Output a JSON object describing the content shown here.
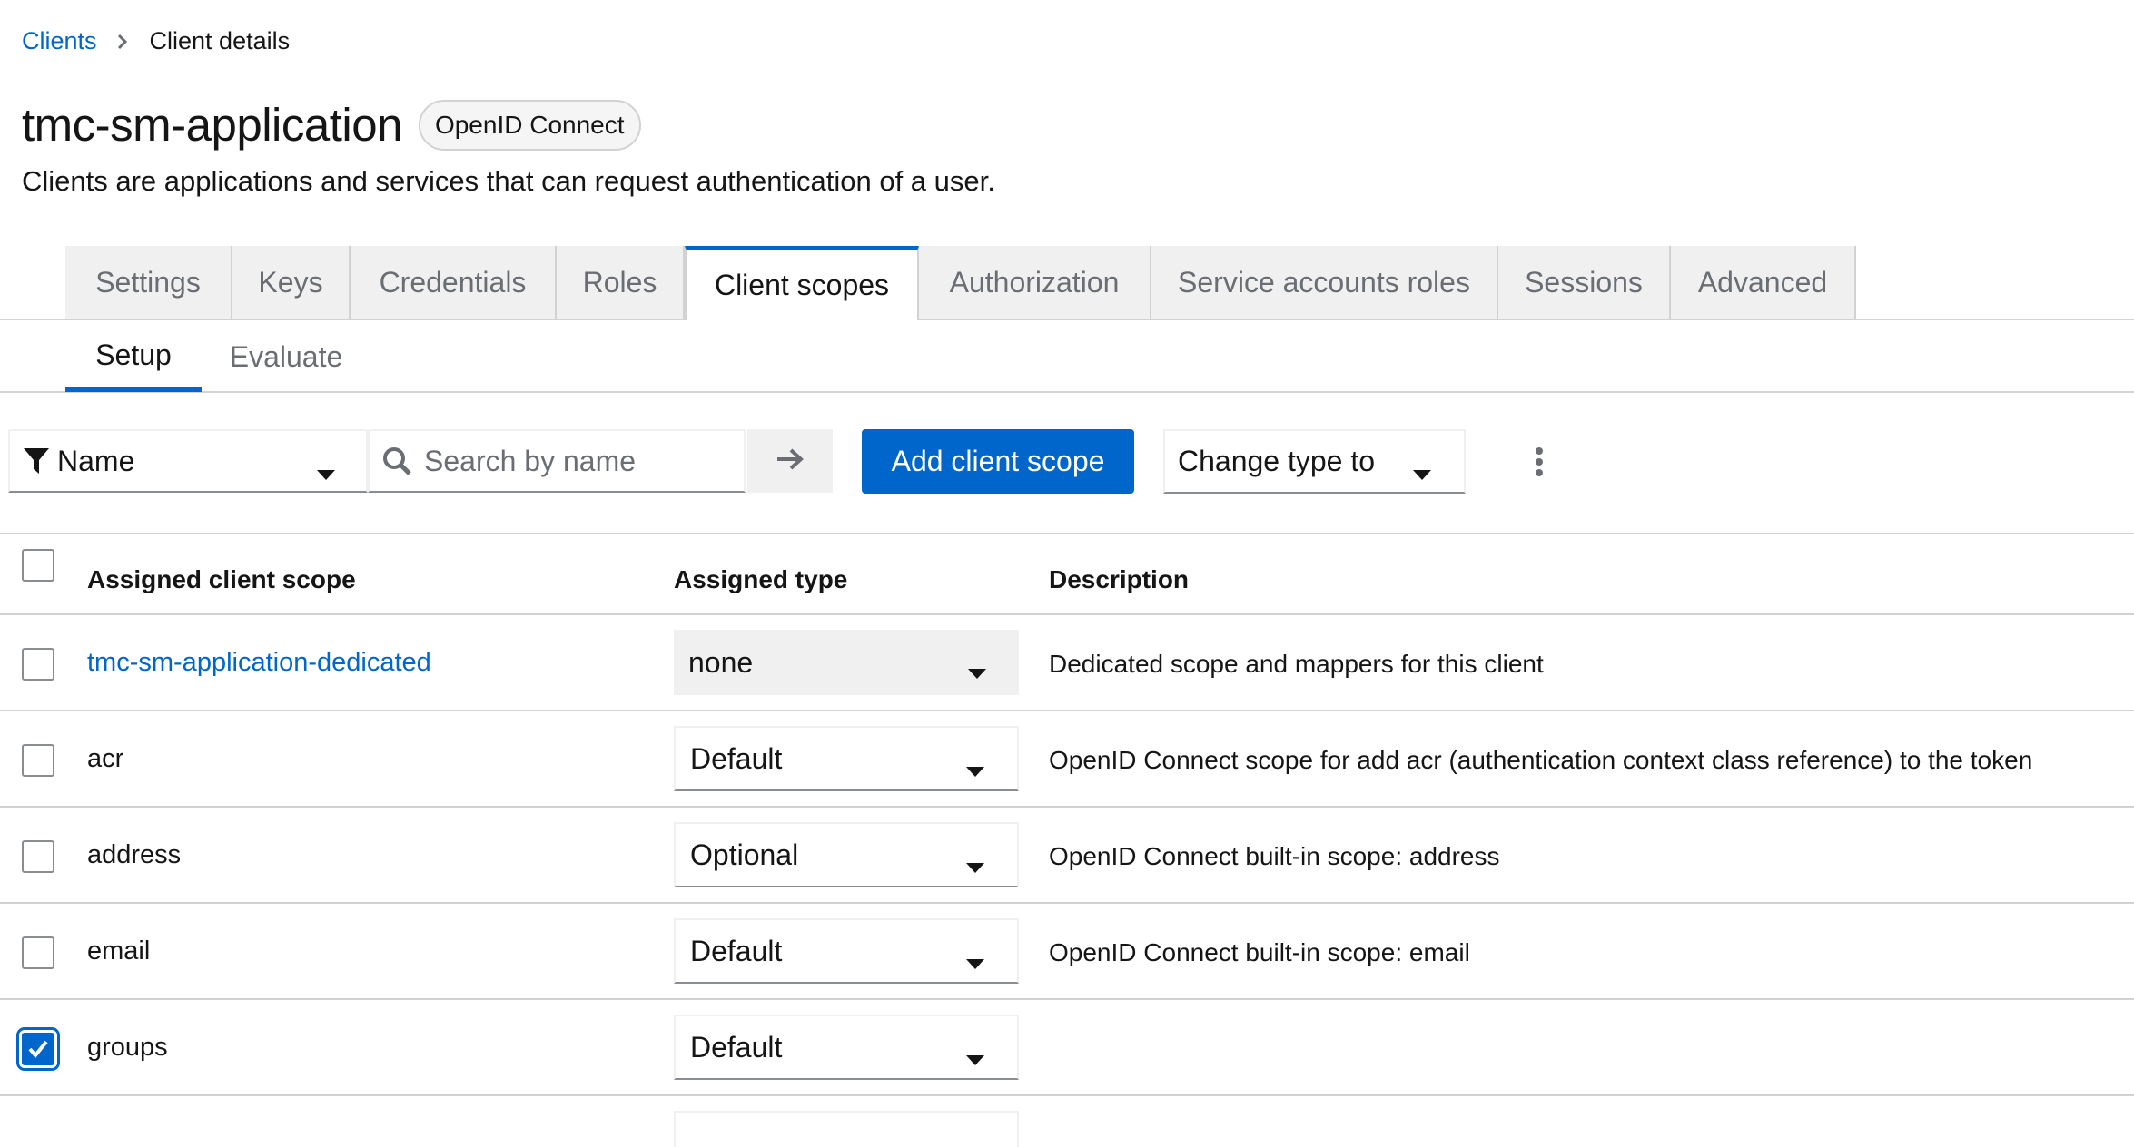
{
  "breadcrumb": {
    "parent": "Clients",
    "current": "Client details"
  },
  "header": {
    "title": "tmc-sm-application",
    "badge": "OpenID Connect",
    "subtitle": "Clients are applications and services that can request authentication of a user."
  },
  "tabs": [
    {
      "label": "Settings"
    },
    {
      "label": "Keys"
    },
    {
      "label": "Credentials"
    },
    {
      "label": "Roles"
    },
    {
      "label": "Client scopes",
      "active": true
    },
    {
      "label": "Authorization"
    },
    {
      "label": "Service accounts roles"
    },
    {
      "label": "Sessions"
    },
    {
      "label": "Advanced"
    }
  ],
  "subtabs": [
    {
      "label": "Setup",
      "active": true
    },
    {
      "label": "Evaluate"
    }
  ],
  "toolbar": {
    "filter_value": "Name",
    "search_placeholder": "Search by name",
    "add_label": "Add client scope",
    "change_type_label": "Change type to"
  },
  "table": {
    "headers": {
      "name": "Assigned client scope",
      "type": "Assigned type",
      "description": "Description"
    },
    "rows": [
      {
        "name": "tmc-sm-application-dedicated",
        "type": "none",
        "description": "Dedicated scope and mappers for this client",
        "checked": false,
        "link": true,
        "disabled": true
      },
      {
        "name": "acr",
        "type": "Default",
        "description": "OpenID Connect scope for add acr (authentication context class reference) to the token",
        "checked": false
      },
      {
        "name": "address",
        "type": "Optional",
        "description": "OpenID Connect built-in scope: address",
        "checked": false
      },
      {
        "name": "email",
        "type": "Default",
        "description": "OpenID Connect built-in scope: email",
        "checked": false
      },
      {
        "name": "groups",
        "type": "Default",
        "description": "",
        "checked": true
      }
    ]
  },
  "colors": {
    "accent": "#0066cc",
    "border": "#d2d2d2",
    "tab_bg": "#f0f0f0",
    "muted_text": "#6a6e73"
  }
}
